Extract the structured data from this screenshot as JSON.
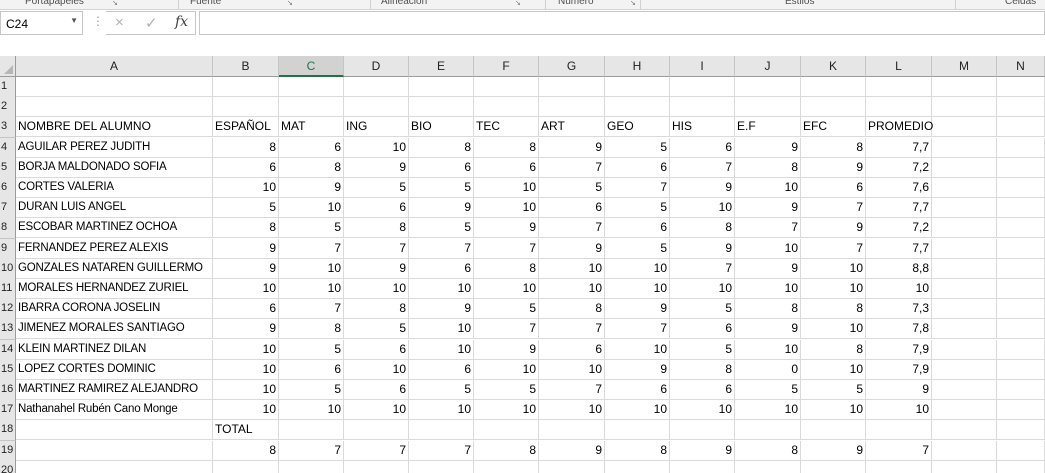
{
  "ribbon": {
    "groups": [
      "Portapapeles",
      "Fuente",
      "Alineación",
      "Número",
      "Estilos",
      "Celdas"
    ]
  },
  "formula_bar": {
    "name_box": "C24",
    "cancel_icon": "×",
    "enter_icon": "✓",
    "fx_label": "fx",
    "formula": ""
  },
  "sheet": {
    "selected_column": "C",
    "columns": [
      "A",
      "B",
      "C",
      "D",
      "E",
      "F",
      "G",
      "H",
      "I",
      "J",
      "K",
      "L",
      "M",
      "N"
    ],
    "row_numbers": [
      "1",
      "2",
      "3",
      "4",
      "5",
      "6",
      "7",
      "8",
      "9",
      "10",
      "11",
      "12",
      "13",
      "14",
      "15",
      "16",
      "17",
      "18",
      "19",
      "20"
    ],
    "headers": [
      "NOMBRE DEL ALUMNO",
      "ESPAÑOL",
      "MAT",
      "ING",
      "BIO",
      "TEC",
      "ART",
      "GEO",
      "HIS",
      "E.F",
      "EFC",
      "PROMEDIO"
    ],
    "students": [
      {
        "name": "AGUILAR PEREZ JUDITH",
        "grades": [
          "8",
          "6",
          "10",
          "8",
          "8",
          "9",
          "5",
          "6",
          "9",
          "8"
        ],
        "avg": "7,7"
      },
      {
        "name": "BORJA MALDONADO SOFIA",
        "grades": [
          "6",
          "8",
          "9",
          "6",
          "6",
          "7",
          "6",
          "7",
          "8",
          "9"
        ],
        "avg": "7,2"
      },
      {
        "name": "CORTES VALERIA",
        "grades": [
          "10",
          "9",
          "5",
          "5",
          "10",
          "5",
          "7",
          "9",
          "10",
          "6"
        ],
        "avg": "7,6"
      },
      {
        "name": "DURAN LUIS ANGEL",
        "grades": [
          "5",
          "10",
          "6",
          "9",
          "10",
          "6",
          "5",
          "10",
          "9",
          "7"
        ],
        "avg": "7,7"
      },
      {
        "name": "ESCOBAR MARTINEZ OCHOA",
        "grades": [
          "8",
          "5",
          "8",
          "5",
          "9",
          "7",
          "6",
          "8",
          "7",
          "9"
        ],
        "avg": "7,2"
      },
      {
        "name": "FERNANDEZ PEREZ ALEXIS",
        "grades": [
          "9",
          "7",
          "7",
          "7",
          "7",
          "9",
          "5",
          "9",
          "10",
          "7"
        ],
        "avg": "7,7"
      },
      {
        "name": "GONZALES NATAREN GUILLERMO",
        "grades": [
          "9",
          "10",
          "9",
          "6",
          "8",
          "10",
          "10",
          "7",
          "9",
          "10"
        ],
        "avg": "8,8"
      },
      {
        "name": "MORALES HERNANDEZ ZURIEL",
        "grades": [
          "10",
          "10",
          "10",
          "10",
          "10",
          "10",
          "10",
          "10",
          "10",
          "10"
        ],
        "avg": "10"
      },
      {
        "name": "IBARRA CORONA JOSELIN",
        "grades": [
          "6",
          "7",
          "8",
          "9",
          "5",
          "8",
          "9",
          "5",
          "8",
          "8"
        ],
        "avg": "7,3"
      },
      {
        "name": "JIMENEZ MORALES SANTIAGO",
        "grades": [
          "9",
          "8",
          "5",
          "10",
          "7",
          "7",
          "7",
          "6",
          "9",
          "10"
        ],
        "avg": "7,8"
      },
      {
        "name": "KLEIN MARTINEZ DILAN",
        "grades": [
          "10",
          "5",
          "6",
          "10",
          "9",
          "6",
          "10",
          "5",
          "10",
          "8"
        ],
        "avg": "7,9"
      },
      {
        "name": "LOPEZ CORTES DOMINIC",
        "grades": [
          "10",
          "6",
          "10",
          "6",
          "10",
          "10",
          "9",
          "8",
          "0",
          "10"
        ],
        "avg": "7,9"
      },
      {
        "name": "MARTINEZ RAMIREZ ALEJANDRO",
        "grades": [
          "10",
          "5",
          "6",
          "5",
          "5",
          "7",
          "6",
          "6",
          "5",
          "5"
        ],
        "avg": "9"
      },
      {
        "name": "Nathanahel Rubén Cano Monge",
        "grades": [
          "10",
          "10",
          "10",
          "10",
          "10",
          "10",
          "10",
          "10",
          "10",
          "10"
        ],
        "avg": "10"
      }
    ],
    "total_label": "TOTAL",
    "totals": [
      "8",
      "7",
      "7",
      "7",
      "8",
      "9",
      "8",
      "9",
      "8",
      "9",
      "7"
    ]
  }
}
